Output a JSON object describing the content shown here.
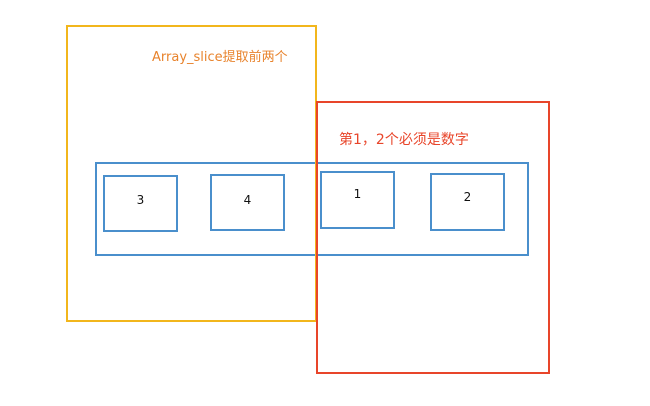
{
  "labels": {
    "orange": "Array_slice提取前两个",
    "red": "第1，2个必须是数字"
  },
  "cells": [
    "3",
    "4",
    "1",
    "2"
  ],
  "colors": {
    "orange": "#f2b61c",
    "orange_text": "#e8832c",
    "red": "#e8452a",
    "blue": "#4a8fcc"
  }
}
